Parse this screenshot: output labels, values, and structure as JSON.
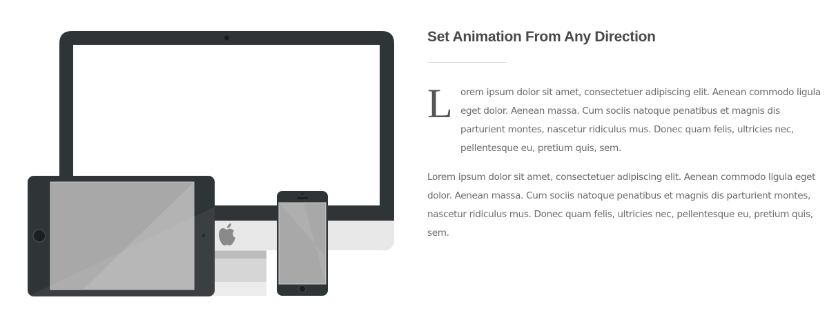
{
  "section": {
    "title": "Set Animation From Any Direction",
    "dropcap_letter": "L",
    "paragraph_1_rest": "orem ipsum dolor sit amet, consectetuer adipiscing elit. Aenean commodo ligula eget dolor. Aenean massa. Cum sociis natoque penatibus et magnis dis parturient montes, nascetur ridiculus mus. Donec quam felis, ultricies nec, pellentesque eu, pretium quis, sem.",
    "paragraph_2": "Lorem ipsum dolor sit amet, consectetuer adipiscing elit. Aenean commodo ligula eget dolor. Aenean massa. Cum sociis natoque penatibus et magnis dis parturient montes, nascetur ridiculus mus. Donec quam felis, ultricies nec, pellentesque eu, pretium quis, sem."
  },
  "illustration": {
    "devices": [
      "desktop-monitor",
      "tablet",
      "smartphone"
    ],
    "colors": {
      "device_frame": "#2f3436",
      "monitor_chin": "#e8e8e8",
      "screen_grey": "#a8a8a8",
      "stand": "#cfcfcf",
      "text_heading": "#4a4a4a",
      "text_body": "#6b6b6b"
    }
  }
}
